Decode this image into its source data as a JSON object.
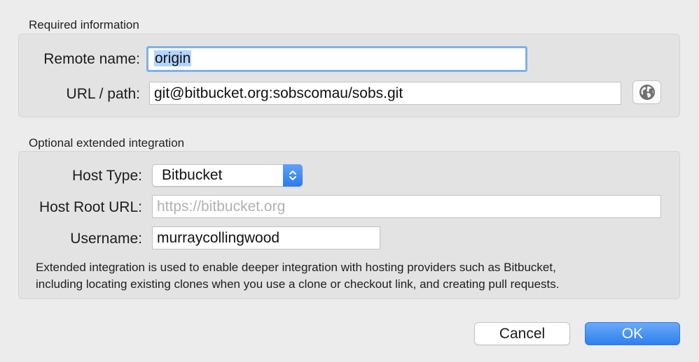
{
  "required": {
    "section_title": "Required information",
    "remote_name_label": "Remote name:",
    "remote_name_value": "origin",
    "url_label": "URL / path:",
    "url_value": "git@bitbucket.org:sobscomau/sobs.git",
    "browse_icon": "globe-icon"
  },
  "optional": {
    "section_title": "Optional extended integration",
    "host_type_label": "Host Type:",
    "host_type_value": "Bitbucket",
    "host_root_label": "Host Root URL:",
    "host_root_placeholder": "https://bitbucket.org",
    "username_label": "Username:",
    "username_value": "murraycollingwood",
    "help_text_line1": "Extended integration is used to enable deeper integration with hosting providers such as Bitbucket,",
    "help_text_line2": "including locating existing clones when you use a clone or checkout link, and creating pull requests."
  },
  "buttons": {
    "cancel_label": "Cancel",
    "ok_label": "OK"
  },
  "colors": {
    "accent": "#2f7ff0",
    "focus_ring": "#7fb0ea",
    "selection": "#b3d4fc"
  }
}
